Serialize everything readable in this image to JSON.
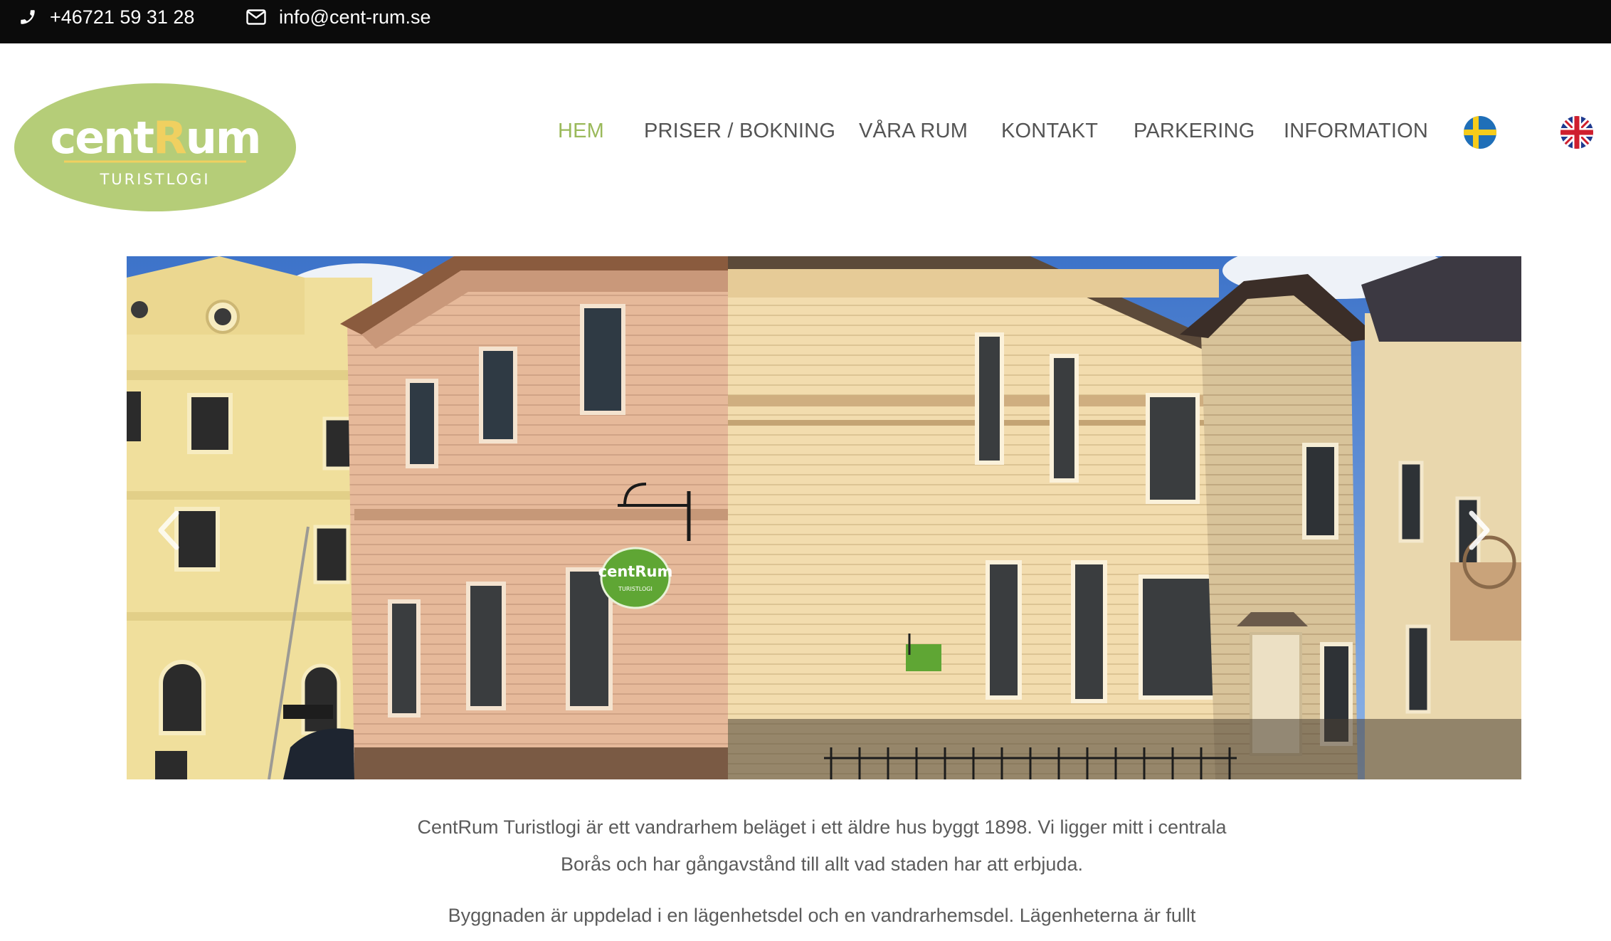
{
  "topbar": {
    "phone": "+46721 59 31 28",
    "email": "info@cent-rum.se",
    "phone_icon": "phone-icon",
    "email_icon": "envelope-icon"
  },
  "logo": {
    "word_part1": "cent",
    "word_part2": "R",
    "word_part3": "um",
    "subtitle": "TURISTLOGI"
  },
  "nav": {
    "items": [
      {
        "label": "HEM",
        "active": true
      },
      {
        "label": "PRISER / BOKNING",
        "active": false
      },
      {
        "label": "VÅRA RUM",
        "active": false
      },
      {
        "label": "KONTAKT",
        "active": false
      },
      {
        "label": "PARKERING",
        "active": false
      },
      {
        "label": "INFORMATION",
        "active": false
      }
    ],
    "languages": [
      {
        "icon": "swedish-flag-icon"
      },
      {
        "icon": "uk-flag-icon"
      }
    ]
  },
  "slider": {
    "prev_icon": "chevron-left-icon",
    "next_icon": "chevron-right-icon",
    "sign_text": "centRum",
    "sign_sub": "TURISTLOGI"
  },
  "content": {
    "paragraph_1": "CentRum Turistlogi är ett vandrarhem beläget i ett äldre hus byggt 1898. Vi ligger mitt i centrala Borås och har gångavstånd till allt vad staden har att erbjuda.",
    "paragraph_2": "Byggnaden är uppdelad i en lägenhetsdel och en vandrarhemsdel. Lägenheterna är fullt"
  },
  "colors": {
    "brand_green": "#9ab95a",
    "logo_green": "#b5cd78",
    "logo_yellow": "#f0d060",
    "topbar_bg": "#0b0b0b",
    "nav_text": "#545454",
    "body_text": "#5b5b5b"
  }
}
